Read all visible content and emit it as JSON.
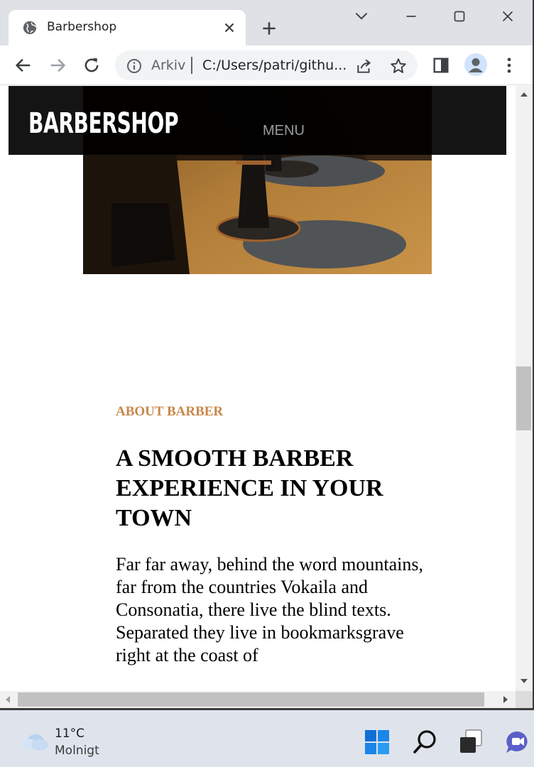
{
  "browser": {
    "tab_title": "Barbershop",
    "address_scheme": "Arkiv",
    "address_url": "C:/Users/patri/githu..."
  },
  "site": {
    "logo": "BARBERSHOP",
    "menu_label": "MENU",
    "about": {
      "kicker": "ABOUT BARBER",
      "heading": "A SMOOTH BARBER EXPERIENCE IN YOUR TOWN",
      "paragraph": "Far far away, behind the word mountains, far from the countries Vokaila and Consonatia, there live the blind texts. Separated they live in bookmarksgrave right at the coast of"
    }
  },
  "taskbar": {
    "temperature": "11°C",
    "condition": "Molnigt"
  },
  "colors": {
    "accent": "#c8874a",
    "nav_bg": "#000000",
    "tabbar_bg": "#dee1e6",
    "taskbar_bg": "#dfe4ec"
  },
  "icons": [
    "globe-icon",
    "close-icon",
    "plus-icon",
    "chevron-down-icon",
    "minimize-icon",
    "maximize-icon",
    "window-close-icon",
    "back-icon",
    "forward-icon",
    "reload-icon",
    "info-icon",
    "share-icon",
    "star-icon",
    "side-panel-icon",
    "profile-icon",
    "more-icon",
    "cloud-icon",
    "windows-start-icon",
    "search-icon",
    "task-view-icon",
    "chat-icon"
  ]
}
